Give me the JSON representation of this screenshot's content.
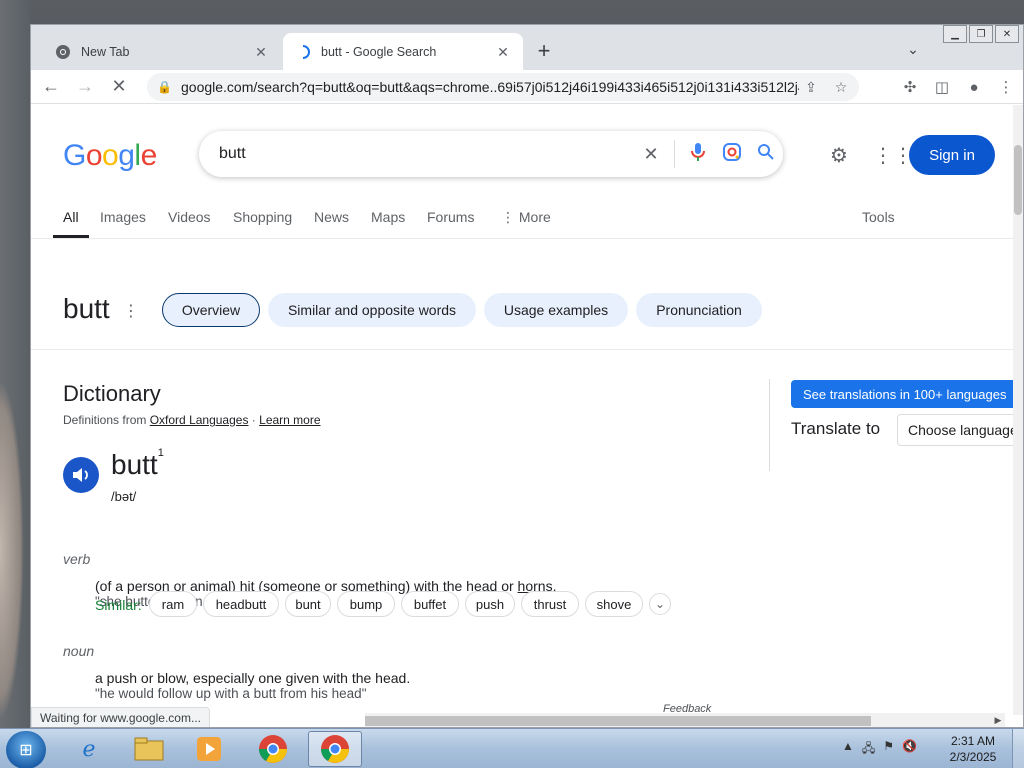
{
  "browser": {
    "tabs": [
      {
        "title": "New Tab",
        "active": false
      },
      {
        "title": "butt - Google Search",
        "active": true
      }
    ],
    "url": "google.com/search?q=butt&oq=butt&aqs=chrome..69i57j0i512j46i199i433i465i512j0i131i433i512l2j4...",
    "status": "Waiting for www.google.com..."
  },
  "google": {
    "logo": [
      "G",
      "o",
      "o",
      "g",
      "l",
      "e"
    ],
    "query": "butt",
    "signin_label": "Sign in",
    "nav": [
      "All",
      "Images",
      "Videos",
      "Shopping",
      "News",
      "Maps",
      "Forums",
      "More",
      "Tools"
    ]
  },
  "word_header": {
    "word": "butt",
    "chips": [
      "Overview",
      "Similar and opposite words",
      "Usage examples",
      "Pronunciation"
    ]
  },
  "dictionary": {
    "heading": "Dictionary",
    "source_prefix": "Definitions from",
    "source_link": "Oxford Languages",
    "separator": " · ",
    "learn_more": "Learn more",
    "headword": "butt",
    "superscript": "1",
    "phonetic": "/bət/",
    "verb": {
      "pos": "verb",
      "def_text": "(of a person or animal) hit (someone or something) with the head or ",
      "def_link": "horns",
      "def_end": ".",
      "example": "\"she butted him in the chest\"",
      "similar_label": "Similar:",
      "similar": [
        "ram",
        "headbutt",
        "bunt",
        "bump",
        "buffet",
        "push",
        "thrust",
        "shove"
      ]
    },
    "noun": {
      "pos": "noun",
      "definition": "a push or blow, especially one given with the head.",
      "example": "\"he would follow up with a butt from his head\""
    },
    "feedback": "Feedback"
  },
  "translate": {
    "button": "See translations in 100+ languages",
    "label": "Translate to",
    "choose": "Choose language"
  },
  "taskbar": {
    "time": "2:31 AM",
    "date": "2/3/2025"
  }
}
